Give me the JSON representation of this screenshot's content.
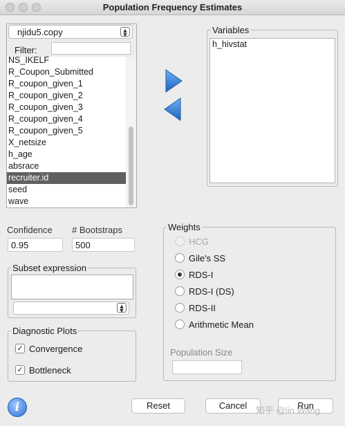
{
  "window": {
    "title": "Population Frequency Estimates"
  },
  "dataset_combo": {
    "value": "njidu5.copy"
  },
  "filter": {
    "label": "Filter:",
    "value": ""
  },
  "variable_list": {
    "items": [
      "NS_IKELF",
      "R_Coupon_Submitted",
      "R_coupon_given_1",
      "R_coupon_given_2",
      "R_coupon_given_3",
      "R_coupon_given_4",
      "R_coupon_given_5",
      "X_netsize",
      "h_age",
      "absrace",
      "recruiter.id",
      "seed",
      "wave"
    ],
    "selected": "recruiter.id"
  },
  "variables_panel": {
    "title": "Variables",
    "items": [
      "h_hivstat"
    ]
  },
  "confidence": {
    "label": "Confidence",
    "value": "0.95"
  },
  "bootstraps": {
    "label": "# Bootstraps",
    "value": "500"
  },
  "subset": {
    "title": "Subset expression",
    "value": ""
  },
  "diagnostics": {
    "title": "Diagnostic Plots",
    "convergence_label": "Convergence",
    "bottleneck_label": "Bottleneck",
    "convergence_checked": true,
    "bottleneck_checked": true
  },
  "weights": {
    "title": "Weights",
    "options": [
      "HCG",
      "Gile's SS",
      "RDS-I",
      "RDS-I (DS)",
      "RDS-II",
      "Arithmetic Mean"
    ],
    "selected": "RDS-I",
    "disabled": [
      "HCG"
    ],
    "population_size_label": "Population Size",
    "population_size_value": ""
  },
  "buttons": {
    "reset": "Reset",
    "cancel": "Cancel",
    "run": "Run"
  },
  "info_glyph": "i",
  "icons": {
    "add_arrow": "arrow-right-icon",
    "remove_arrow": "arrow-left-icon",
    "info": "info-icon"
  },
  "colors": {
    "arrow_blue": "#3a86d8",
    "selection": "#5f5f5f",
    "info_blue": "#2c6fd1"
  },
  "watermark": "知乎 @lin Wang"
}
